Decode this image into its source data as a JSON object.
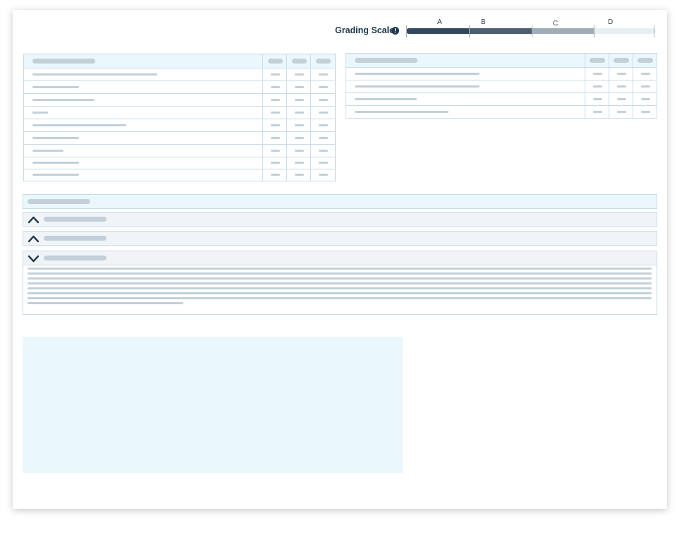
{
  "grading_scale": {
    "label": "Grading Scale",
    "info_icon": "info-icon",
    "segments": [
      {
        "letter": "A",
        "color": "#34485c"
      },
      {
        "letter": "B",
        "color": "#4b5f71"
      },
      {
        "letter": "C",
        "color": "#9fadb7"
      },
      {
        "letter": "D",
        "color": "#e8eff3"
      }
    ]
  },
  "accordion": {
    "items": [
      {
        "state": "expanded",
        "icon": "chevron-up-icon"
      },
      {
        "state": "expanded",
        "icon": "chevron-up-icon"
      },
      {
        "state": "collapsed",
        "icon": "chevron-down-icon"
      }
    ]
  },
  "colors": {
    "accent_dark": "#1e3a52",
    "header_bg": "#eaf7fd",
    "border": "#c9dbe6",
    "placeholder": "#c3d0d9"
  }
}
